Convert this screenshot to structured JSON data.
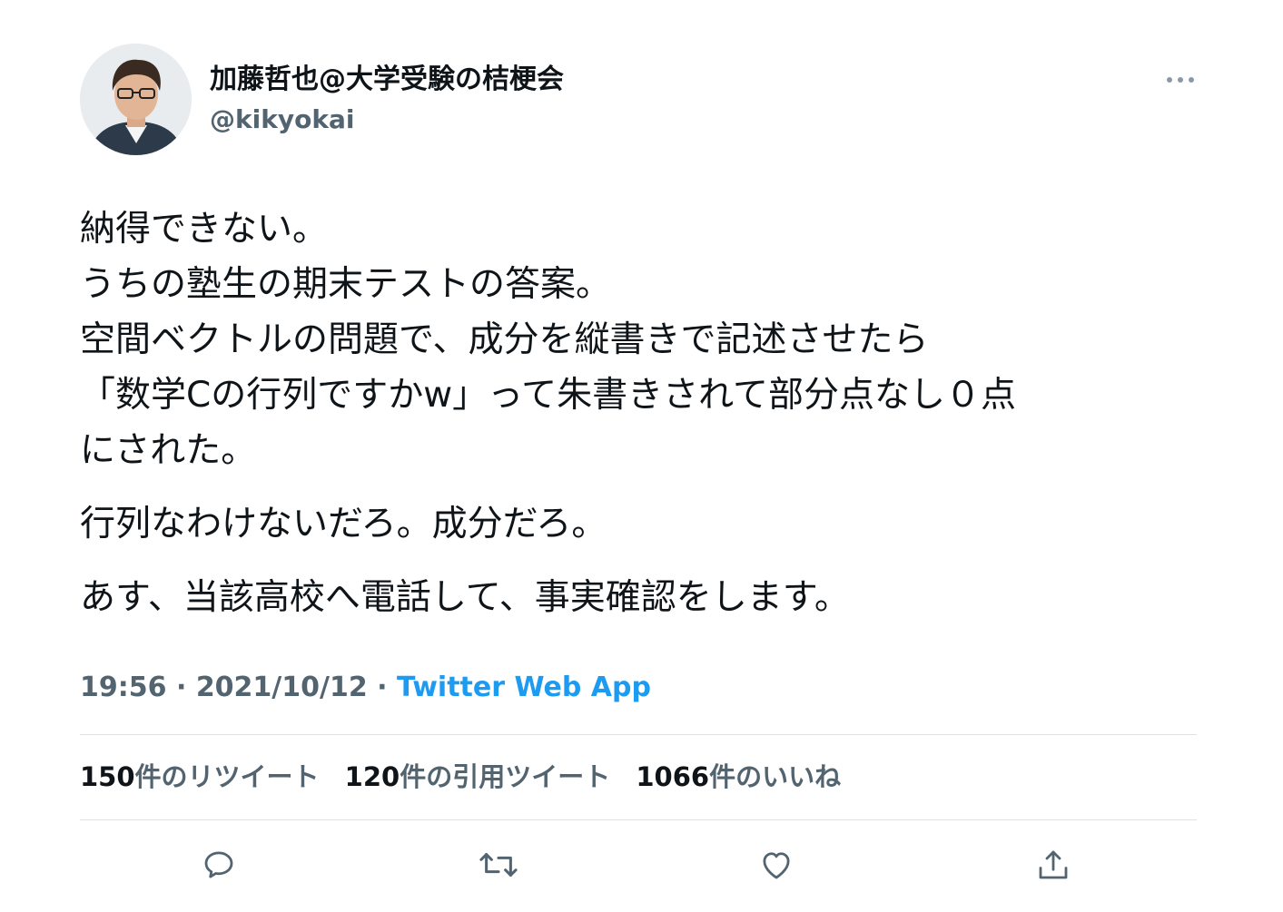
{
  "author": {
    "display_name": "加藤哲也@大学受験の桔梗会",
    "handle": "@kikyokai"
  },
  "tweet": {
    "paragraphs": [
      {
        "lines": [
          "納得できない。",
          "うちの塾生の期末テストの答案。",
          "空間ベクトルの問題で、成分を縦書きで記述させたら",
          "「数学Cの行列ですかw」って朱書きされて部分点なし０点",
          "にされた。"
        ]
      },
      {
        "lines": [
          "行列なわけないだろ。成分だろ。"
        ]
      },
      {
        "lines": [
          "あす、当該高校へ電話して、事実確認をします。"
        ]
      }
    ],
    "time": "19:56",
    "separator": "·",
    "date": "2021/10/12",
    "source": "Twitter Web App"
  },
  "stats": {
    "retweets": {
      "count": "150",
      "label": "件のリツイート"
    },
    "quotes": {
      "count": "120",
      "label": "件の引用ツイート"
    },
    "likes": {
      "count": "1066",
      "label": "件のいいね"
    }
  },
  "icons": {
    "more": "more-horizontal-icon",
    "reply": "reply-icon",
    "retweet": "retweet-icon",
    "like": "heart-icon",
    "share": "share-icon"
  },
  "colors": {
    "text": "#0f1419",
    "secondary": "#536471",
    "accent": "#1d9bf0",
    "divider": "#dfe3e6"
  }
}
